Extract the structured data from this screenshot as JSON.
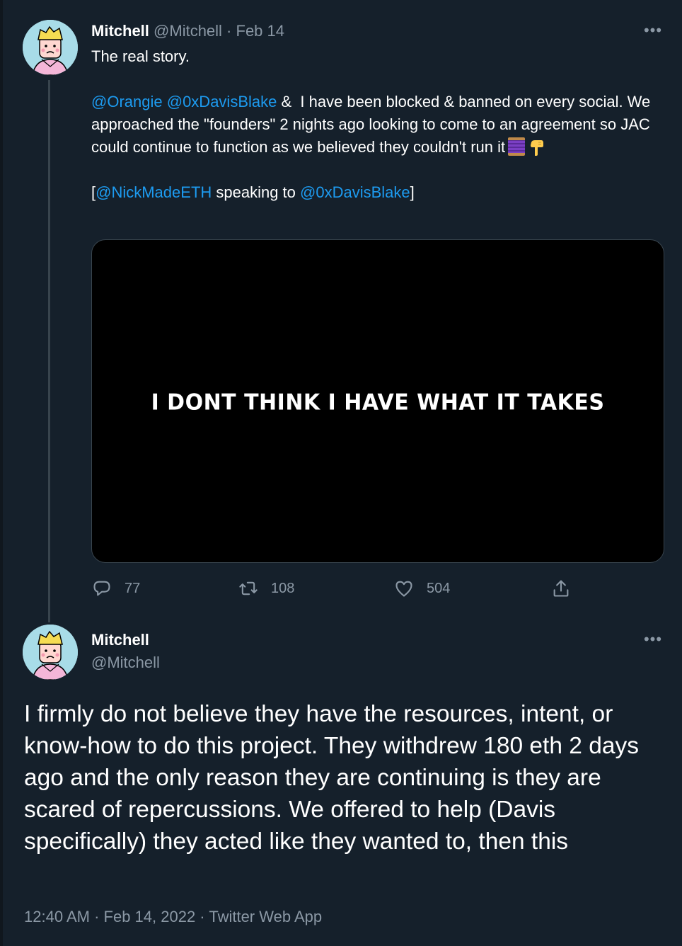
{
  "tweet1": {
    "author_name": "Mitchell",
    "author_handle": "@Mitchell",
    "separator": " · ",
    "date": "Feb 14",
    "text_line1": "The real story.",
    "mention1": "@Orangie",
    "mention2": "@0xDavisBlake",
    "text_p2a": " &  I have been blocked & banned on every social. We approached the \"founders\" 2 nights ago looking to come to an agreement so JAC could continue to function as we believed they couldn't run it",
    "bracket_open": "[",
    "mention3": "@NickMadeETH",
    "speaking_to": " speaking to ",
    "mention4": "@0xDavisBlake",
    "bracket_close": "]",
    "media_caption": "I DONT THINK I HAVE WHAT IT TAKES",
    "replies": "77",
    "retweets": "108",
    "likes": "504"
  },
  "tweet2": {
    "author_name": "Mitchell",
    "author_handle": "@Mitchell",
    "text": "I firmly do not believe they have the resources, intent, or know-how to do this project. They withdrew 180 eth 2 days ago and the only reason they are continuing is they are scared of repercussions. We offered to help (Davis specifically) they acted like they wanted to, then this",
    "time": "12:40 AM",
    "separator1": " · ",
    "date": "Feb 14, 2022",
    "separator2": " · ",
    "source": "Twitter Web App"
  },
  "icons": {
    "more": "more-icon",
    "reply": "reply-icon",
    "retweet": "retweet-icon",
    "like": "like-icon",
    "share": "share-icon"
  },
  "colors": {
    "background": "#15202b",
    "link": "#1d9bf0",
    "muted": "#8b98a5",
    "border": "#38444d"
  }
}
